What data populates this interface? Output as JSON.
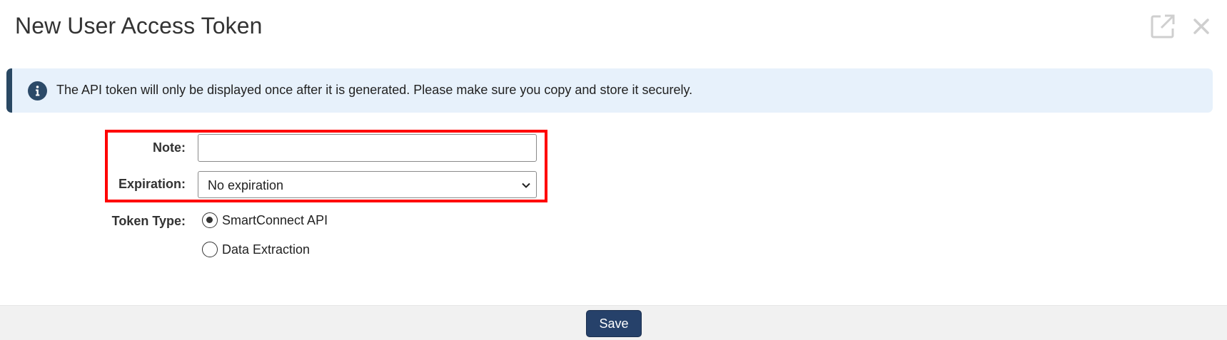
{
  "dialog": {
    "title": "New User Access Token",
    "popout_icon": "popout-icon",
    "close_icon": "close-icon"
  },
  "info": {
    "icon": "info-icon",
    "text": "The API token will only be displayed once after it is generated. Please make sure you copy and store it securely."
  },
  "form": {
    "note": {
      "label": "Note:",
      "value": "",
      "placeholder": ""
    },
    "expiration": {
      "label": "Expiration:",
      "selected": "No expiration"
    },
    "token_type": {
      "label": "Token Type:",
      "options": [
        {
          "label": "SmartConnect API",
          "selected": true
        },
        {
          "label": "Data Extraction",
          "selected": false
        }
      ]
    }
  },
  "footer": {
    "save_label": "Save"
  },
  "colors": {
    "highlight": "#ff0000",
    "banner_bg": "#e7f1fb",
    "banner_accent": "#2a4863",
    "primary_button": "#26416a",
    "footer_bg": "#f1f1f1"
  }
}
